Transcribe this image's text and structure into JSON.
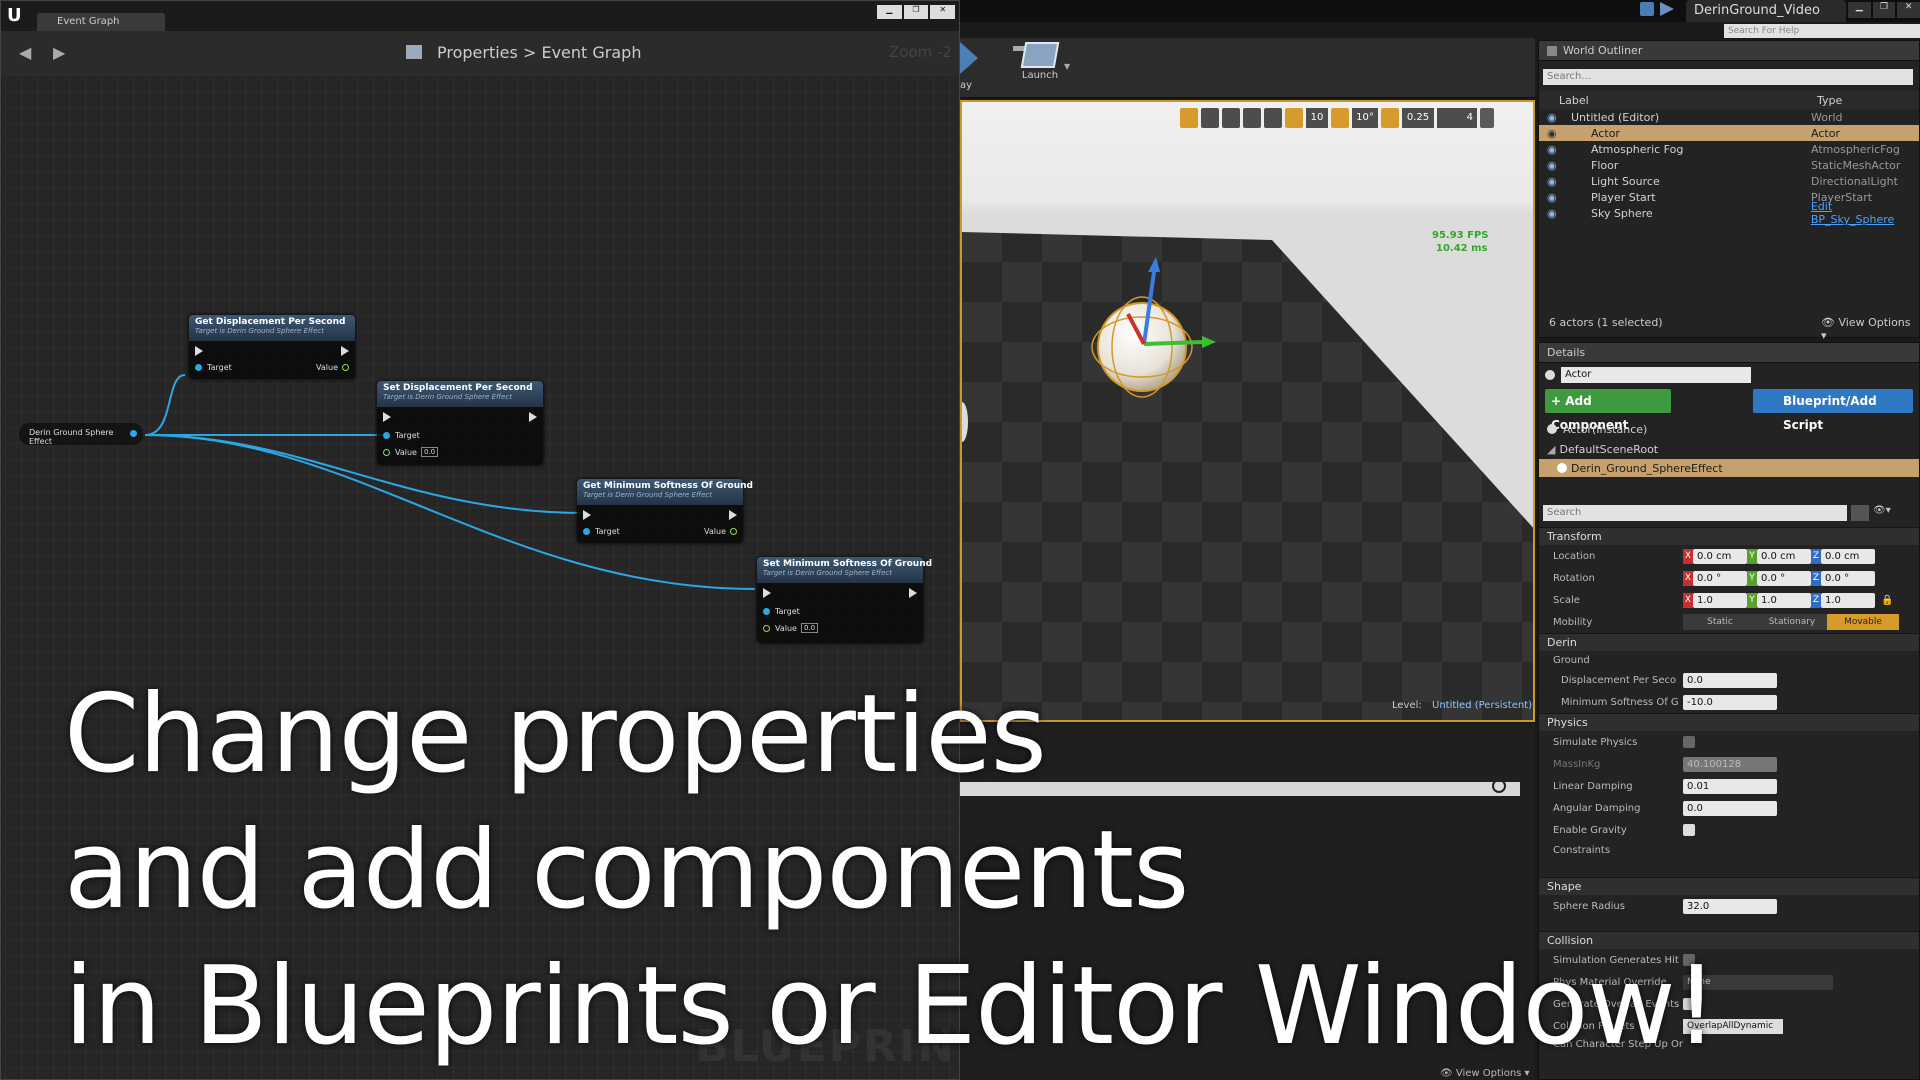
{
  "blueprint": {
    "tab_title": "Event Graph",
    "breadcrumb_root": "Properties",
    "breadcrumb_sep": ">",
    "breadcrumb_leaf": "Event Graph",
    "zoom": "Zoom -2",
    "watermark": "BLUEPRINT",
    "nodes": {
      "source": "Derin Ground Sphere Effect",
      "get_disp": {
        "title": "Get Displacement Per Second",
        "sub": "Target is Derin Ground Sphere Effect",
        "target": "Target",
        "value": "Value"
      },
      "set_disp": {
        "title": "Set Displacement Per Second",
        "sub": "Target is Derin Ground Sphere Effect",
        "target": "Target",
        "value": "Value",
        "val": "0.0"
      },
      "get_soft": {
        "title": "Get Minimum Softness Of Ground",
        "sub": "Target is Derin Ground Sphere Effect",
        "target": "Target",
        "value": "Value"
      },
      "set_soft": {
        "title": "Set Minimum Softness Of Ground",
        "sub": "Target is Derin Ground Sphere Effect",
        "target": "Target",
        "value": "Value",
        "val": "0.0"
      }
    }
  },
  "window": {
    "project_title": "DerinGround_Video",
    "search_help": "Search For Help"
  },
  "toolbar": {
    "play_label": "ay",
    "launch_label": "Launch"
  },
  "viewport": {
    "fps": "95.93 FPS",
    "ms": "10.42 ms",
    "level_label": "Level:",
    "level_value": "Untitled (Persistent)",
    "grid_snap": "10",
    "rot_snap": "10°",
    "scale_snap": "0.25",
    "cam_speed": "4"
  },
  "outliner": {
    "tab": "World Outliner",
    "search_placeholder": "Search...",
    "col_label": "Label",
    "col_type": "Type",
    "rows": [
      {
        "label": "Untitled (Editor)",
        "type": "World"
      },
      {
        "label": "Actor",
        "type": "Actor"
      },
      {
        "label": "Atmospheric Fog",
        "type": "AtmosphericFog"
      },
      {
        "label": "Floor",
        "type": "StaticMeshActor"
      },
      {
        "label": "Light Source",
        "type": "DirectionalLight"
      },
      {
        "label": "Player Start",
        "type": "PlayerStart"
      },
      {
        "label": "Sky Sphere",
        "type": "Edit BP_Sky_Sphere"
      }
    ],
    "status": "6 actors (1 selected)",
    "view_options": "View Options"
  },
  "details": {
    "tab": "Details",
    "actor_name": "Actor",
    "add_component": "+ Add Component",
    "blueprint_script": "Blueprint/Add Script",
    "instance": "Actor(Instance)",
    "root": "DefaultSceneRoot",
    "component": "Derin_Ground_SphereEffect",
    "search_placeholder": "Search",
    "transform": "Transform",
    "location": "Location",
    "rotation": "Rotation",
    "scale": "Scale",
    "mobility": "Mobility",
    "loc": [
      "0.0 cm",
      "0.0 cm",
      "0.0 cm"
    ],
    "rot": [
      "0.0 °",
      "0.0 °",
      "0.0 °"
    ],
    "scl": [
      "1.0",
      "1.0",
      "1.0"
    ],
    "axes": [
      "X",
      "Y",
      "Z"
    ],
    "mob_static": "Static",
    "mob_stationary": "Stationary",
    "mob_movable": "Movable",
    "derin": "Derin",
    "ground": "Ground",
    "disp_label": "Displacement Per Seco",
    "disp_val": "0.0",
    "soft_label": "Minimum Softness Of G",
    "soft_val": "-10.0",
    "physics": "Physics",
    "simulate": "Simulate Physics",
    "mass_label": "MassInKg",
    "mass_val": "40.100128",
    "lin_damp": "Linear Damping",
    "lin_val": "0.01",
    "ang_damp": "Angular Damping",
    "ang_val": "0.0",
    "gravity": "Enable Gravity",
    "constraints": "Constraints",
    "shape": "Shape",
    "radius_label": "Sphere Radius",
    "radius_val": "32.0",
    "collision": "Collision",
    "sim_hit": "Simulation Generates Hit",
    "phys_mat": "Phys Material Override",
    "phys_mat_val": "None",
    "overlap": "Generate Overlap Events",
    "presets": "Collision Presets",
    "presets_val": "OverlapAllDynamic",
    "step": "Can Character Step Up On",
    "view_options": "View Options"
  },
  "overlay": {
    "line1": "Change properties",
    "line2": "and add components",
    "line3": "in Blueprints or Editor Window!"
  },
  "colors": {
    "accent": "#c89a2a",
    "pin_blue": "#2ba7e6",
    "add_green": "#3f9a3f",
    "bp_blue": "#2f79c4"
  }
}
